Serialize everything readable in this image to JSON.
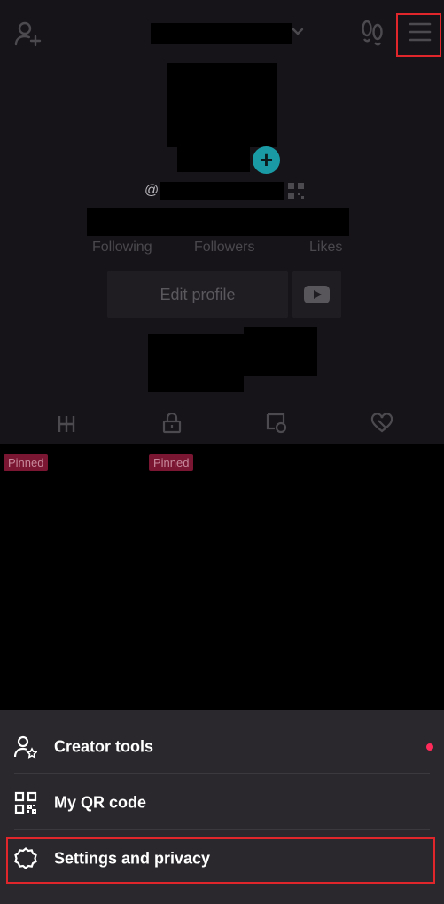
{
  "header": {
    "add_friend_icon": "person-add-icon",
    "footprints_icon": "footprints-icon",
    "menu_icon": "hamburger-menu-icon"
  },
  "profile": {
    "at_prefix": "@",
    "qr_icon": "qr-code-icon",
    "stats": {
      "following_label": "Following",
      "followers_label": "Followers",
      "likes_label": "Likes"
    },
    "edit_profile_label": "Edit profile",
    "youtube_icon": "youtube-icon"
  },
  "content_tabs": [
    "grid-icon",
    "lock-icon",
    "tagged-icon",
    "liked-icon"
  ],
  "pinned_badges": [
    "Pinned",
    "Pinned"
  ],
  "menu_sheet": {
    "items": [
      {
        "label": "Creator tools",
        "icon": "creator-tools-icon",
        "has_notification_dot": true
      },
      {
        "label": "My QR code",
        "icon": "qr-code-icon"
      },
      {
        "label": "Settings and privacy",
        "icon": "settings-gear-icon"
      }
    ]
  },
  "colors": {
    "highlight": "#e0262b",
    "notification_dot": "#ff2a5a",
    "pinned_badge": "#7a1532",
    "plus_badge": "#1a9aa4"
  }
}
